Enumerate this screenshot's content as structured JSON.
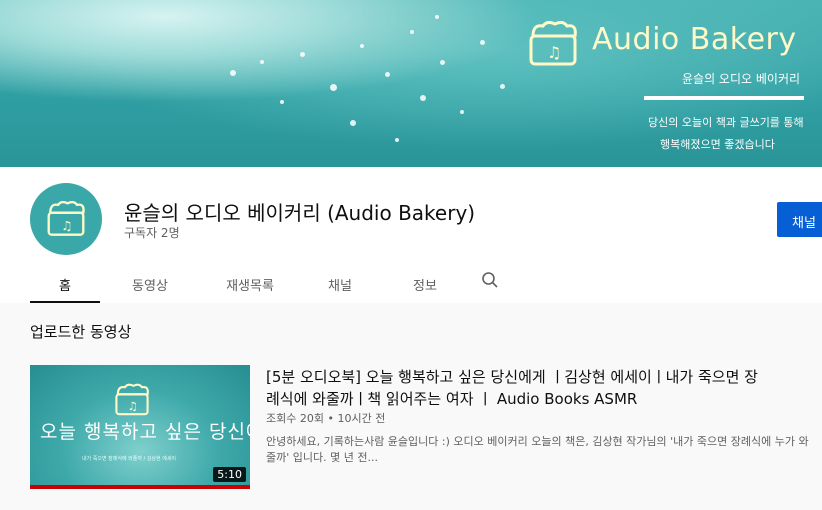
{
  "banner": {
    "brand": "Audio Bakery",
    "subtitle": "윤슬의 오디오 베이커리",
    "tagline_1": "당신의 오늘이 책과 글쓰기를 통해",
    "tagline_2": "행복해졌으면 좋겠습니다"
  },
  "channel": {
    "title": "윤슬의 오디오 베이커리 (Audio Bakery)",
    "subscribers": "구독자 2명",
    "subscribe_label": "채널"
  },
  "tabs": [
    "홈",
    "동영상",
    "재생목록",
    "채널",
    "정보"
  ],
  "section": {
    "title": "업로드한 동영상"
  },
  "video": {
    "thumb_title": "오늘 행복하고 싶은 당신에게",
    "thumb_sub": "내가 죽으면 장례식에 와줄까 / 김상현 에세이",
    "duration": "5:10",
    "title": "[5분 오디오북] 오늘 행복하고 싶은 당신에게 ㅣ김상현 에세이ㅣ내가 죽으면 장례식에 와줄까ㅣ책 읽어주는 여자 ㅣ Audio Books ASMR",
    "meta": "조회수 20회 • 10시간 전",
    "description": "안녕하세요, 기록하는사람 윤슬입니다 :) 오디오 베이커리 오늘의 책은, 김상현 작가님의 '내가 죽으면 장례식에 누가 와줄까' 입니다. 몇 년 전..."
  },
  "colors": {
    "accent": "#065fd4",
    "progress": "#cc0000",
    "banner_teal": "#3aa8a9"
  }
}
